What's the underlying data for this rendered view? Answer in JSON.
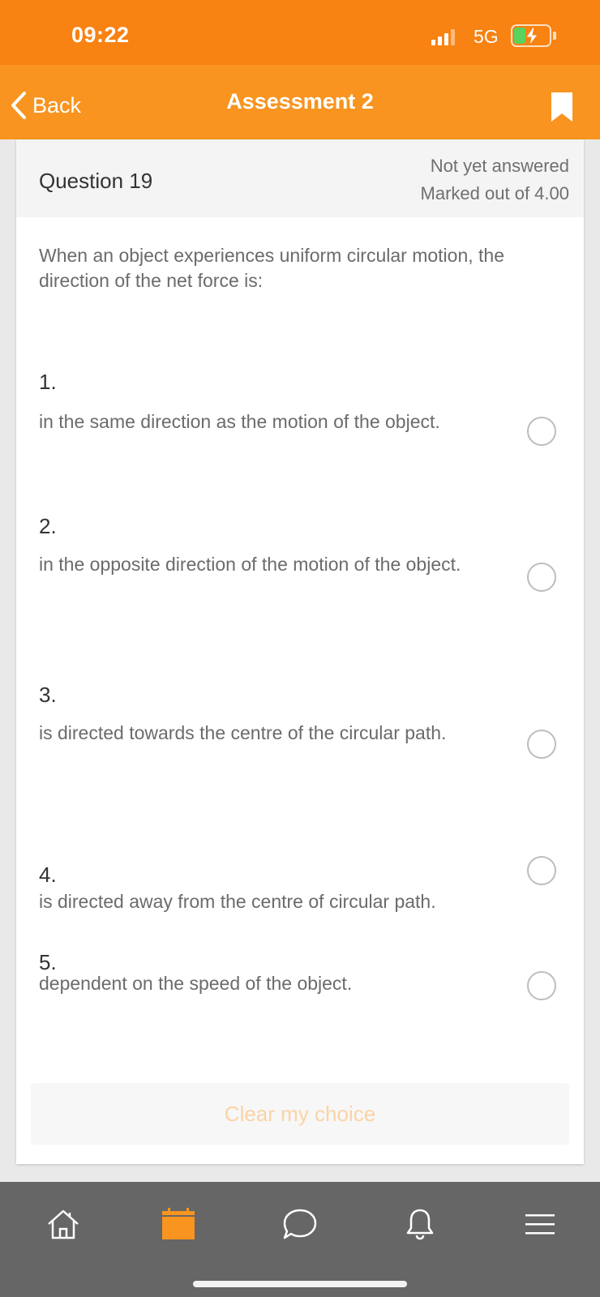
{
  "status_bar": {
    "time": "09:22",
    "network": "5G",
    "battery_icon": "battery-charging-icon",
    "signal_icon": "signal-bars-icon"
  },
  "nav": {
    "back_label": "Back",
    "title": "Assessment 2",
    "bookmark_icon": "bookmark-icon"
  },
  "question": {
    "number_label": "Question 19",
    "status": "Not yet answered",
    "marks": "Marked out of 4.00",
    "text": "When an object experiences uniform circular motion, the direction of the net force is:"
  },
  "options": [
    {
      "number": "1.",
      "text": "in the same direction as the motion of the object.",
      "selected": false
    },
    {
      "number": "2.",
      "text": "in the opposite direction of the motion of the object.",
      "selected": false
    },
    {
      "number": "3.",
      "text": "is directed towards the centre of the circular path.",
      "selected": false
    },
    {
      "number": "4.",
      "text": "is directed away from the centre of circular path.",
      "selected": false
    },
    {
      "number": "5.",
      "text": "dependent on the speed of the object.",
      "selected": false
    }
  ],
  "clear_choice_label": "Clear my choice",
  "tabs": [
    {
      "icon": "home-icon",
      "active": false
    },
    {
      "icon": "calendar-icon",
      "active": true
    },
    {
      "icon": "chat-icon",
      "active": false
    },
    {
      "icon": "bell-icon",
      "active": false
    },
    {
      "icon": "menu-icon",
      "active": false
    }
  ],
  "colors": {
    "status_bar": "#f88212",
    "nav_bar": "#f8941f",
    "accent": "#f8941f",
    "tab_bar": "#666666",
    "clear_text": "#fbd3a6"
  }
}
